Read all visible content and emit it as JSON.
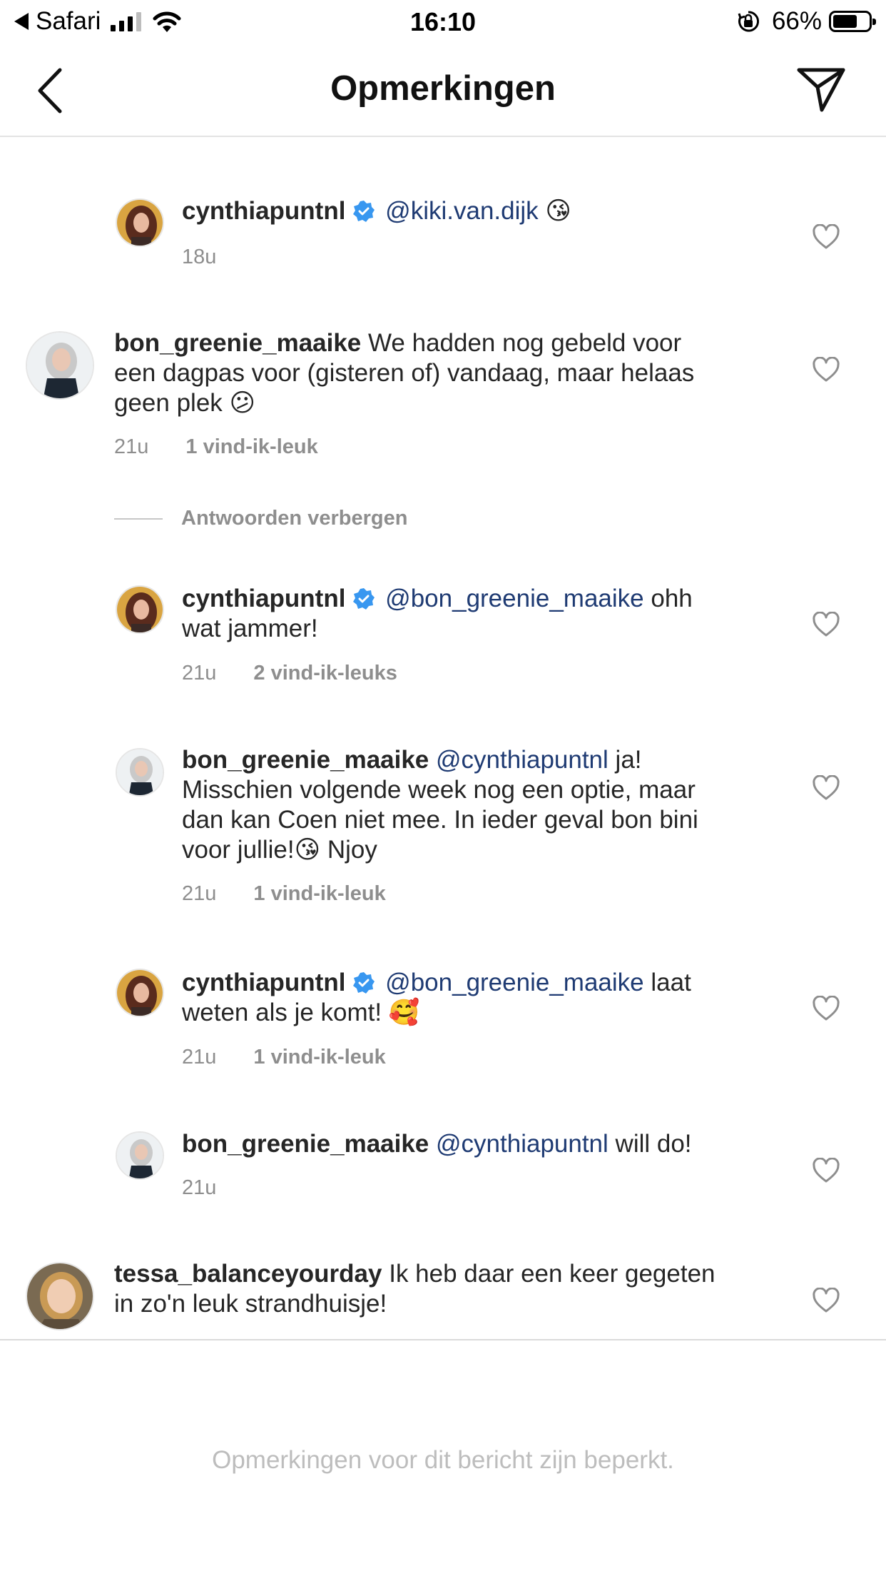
{
  "status_bar": {
    "back_app": "Safari",
    "time": "16:10",
    "battery": "66%"
  },
  "header": {
    "title": "Opmerkingen"
  },
  "comments": [
    {
      "user": "cynthiapuntnl",
      "verified": true,
      "mention": "@kiki.van.dijk",
      "text": "",
      "emoji": "😘",
      "time": "18u",
      "likes": ""
    },
    {
      "user": "bon_greenie_maaike",
      "verified": false,
      "text_line1": "We hadden nog gebeld voor",
      "text_line2": "een dagpas voor (gisteren of) vandaag, maar helaas",
      "text_line3": "geen plek",
      "emoji": "😕",
      "time": "21u",
      "likes": "1 vind-ik-leuk"
    },
    {
      "user": "cynthiapuntnl",
      "verified": true,
      "mention": "@bon_greenie_maaike",
      "text_line1": "ohh",
      "text_line2": "wat jammer!",
      "time": "21u",
      "likes": "2 vind-ik-leuks"
    },
    {
      "user": "bon_greenie_maaike",
      "verified": false,
      "mention": "@cynthiapuntnl",
      "text_line1": "ja!",
      "text_line2": "Misschien volgende week nog een optie, maar",
      "text_line3": "dan kan Coen niet mee. In ieder geval bon bini",
      "text_line4a": "voor jullie!",
      "emoji": "😘",
      "text_line4b": "Njoy",
      "time": "21u",
      "likes": "1 vind-ik-leuk"
    },
    {
      "user": "cynthiapuntnl",
      "verified": true,
      "mention": "@bon_greenie_maaike",
      "text_line1": "laat",
      "text_line2": "weten als je komt!",
      "emoji": "🥰",
      "time": "21u",
      "likes": "1 vind-ik-leuk"
    },
    {
      "user": "bon_greenie_maaike",
      "verified": false,
      "mention": "@cynthiapuntnl",
      "text_line1": "will do!",
      "time": "21u",
      "likes": ""
    },
    {
      "user": "tessa_balanceyourday",
      "verified": false,
      "text_line1": "Ik heb daar een keer gegeten",
      "text_line2": "in zo'n leuk strandhuisje!"
    }
  ],
  "hide_replies_label": "Antwoorden verbergen",
  "footer": {
    "message": "Opmerkingen voor dit bericht zijn beperkt."
  },
  "colors": {
    "mention": "#1f3b73",
    "verified": "#3897f0",
    "meta": "#8e8e8e"
  }
}
